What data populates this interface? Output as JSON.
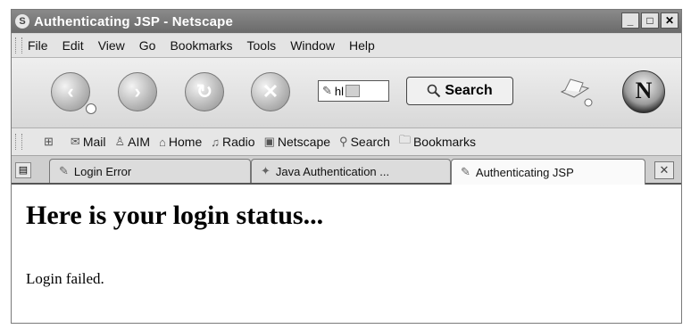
{
  "window": {
    "title": "Authenticating JSP - Netscape",
    "controls": [
      "_",
      "□",
      "✕"
    ]
  },
  "menu": [
    "File",
    "Edit",
    "View",
    "Go",
    "Bookmarks",
    "Tools",
    "Window",
    "Help"
  ],
  "navigation": {
    "back_icon": "back-arrow-icon",
    "forward_icon": "forward-arrow-icon",
    "reload_icon": "reload-icon",
    "stop_icon": "stop-icon",
    "url_value": "hl",
    "search_label": "Search"
  },
  "personal_toolbar": [
    "Mail",
    "AIM",
    "Home",
    "Radio",
    "Netscape",
    "Search",
    "Bookmarks"
  ],
  "tabs": [
    "Login Error",
    "Java Authentication ...",
    "Authenticating JSP"
  ],
  "page": {
    "heading": "Here is your login status...",
    "message": "Login failed."
  }
}
